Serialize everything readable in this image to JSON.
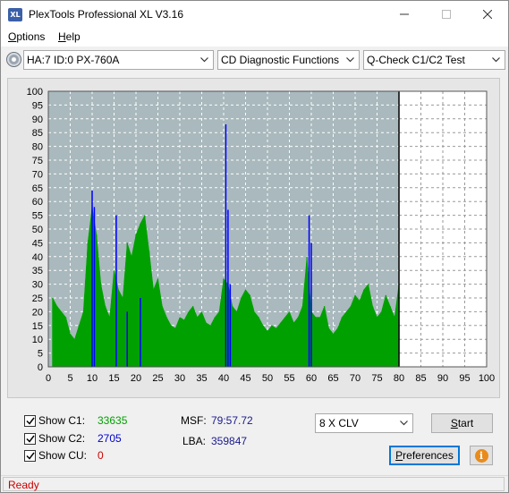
{
  "window": {
    "title": "PlexTools Professional XL V3.16",
    "app_icon_text": "XL"
  },
  "menu": {
    "options": "Options",
    "options_accel": "O",
    "options_rest": "ptions",
    "help": "Help",
    "help_accel": "H",
    "help_rest": "elp"
  },
  "toolbar": {
    "drive": "HA:7 ID:0  PX-760A",
    "function": "CD Diagnostic Functions",
    "test": "Q-Check C1/C2 Test"
  },
  "chart_data": {
    "type": "bar",
    "y_ticks": [
      "100",
      "95",
      "90",
      "85",
      "80",
      "75",
      "70",
      "65",
      "60",
      "55",
      "50",
      "45",
      "40",
      "35",
      "30",
      "25",
      "20",
      "15",
      "10",
      "5",
      "0"
    ],
    "x_ticks": [
      "0",
      "5",
      "10",
      "15",
      "20",
      "25",
      "30",
      "35",
      "40",
      "45",
      "50",
      "55",
      "60",
      "65",
      "70",
      "75",
      "80",
      "85",
      "90",
      "95",
      "100"
    ],
    "xlim": [
      0,
      100
    ],
    "ylim": [
      0,
      100
    ],
    "data_end_x": 80,
    "grid": true,
    "colors": {
      "plot_bg": "#a9b9bd",
      "c1": "#00a000",
      "c2": "#0000ff",
      "grid": "#ffffff",
      "end_marker": "#000000"
    },
    "series": [
      {
        "name": "C1",
        "points": [
          [
            1,
            25
          ],
          [
            2,
            22
          ],
          [
            3,
            20
          ],
          [
            4,
            18
          ],
          [
            5,
            12
          ],
          [
            6,
            10
          ],
          [
            7,
            15
          ],
          [
            8,
            20
          ],
          [
            9,
            45
          ],
          [
            10,
            58
          ],
          [
            11,
            48
          ],
          [
            12,
            30
          ],
          [
            13,
            22
          ],
          [
            14,
            18
          ],
          [
            15,
            35
          ],
          [
            16,
            28
          ],
          [
            17,
            25
          ],
          [
            18,
            45
          ],
          [
            19,
            40
          ],
          [
            20,
            48
          ],
          [
            21,
            52
          ],
          [
            22,
            55
          ],
          [
            23,
            42
          ],
          [
            24,
            28
          ],
          [
            25,
            32
          ],
          [
            26,
            22
          ],
          [
            27,
            18
          ],
          [
            28,
            15
          ],
          [
            29,
            14
          ],
          [
            30,
            18
          ],
          [
            31,
            17
          ],
          [
            32,
            20
          ],
          [
            33,
            22
          ],
          [
            34,
            18
          ],
          [
            35,
            20
          ],
          [
            36,
            16
          ],
          [
            37,
            15
          ],
          [
            38,
            18
          ],
          [
            39,
            20
          ],
          [
            40,
            32
          ],
          [
            41,
            30
          ],
          [
            42,
            22
          ],
          [
            43,
            20
          ],
          [
            44,
            25
          ],
          [
            45,
            28
          ],
          [
            46,
            26
          ],
          [
            47,
            20
          ],
          [
            48,
            18
          ],
          [
            49,
            15
          ],
          [
            50,
            13
          ],
          [
            51,
            15
          ],
          [
            52,
            14
          ],
          [
            53,
            16
          ],
          [
            54,
            18
          ],
          [
            55,
            20
          ],
          [
            56,
            16
          ],
          [
            57,
            18
          ],
          [
            58,
            22
          ],
          [
            59,
            40
          ],
          [
            60,
            20
          ],
          [
            61,
            18
          ],
          [
            62,
            18
          ],
          [
            63,
            22
          ],
          [
            64,
            14
          ],
          [
            65,
            12
          ],
          [
            66,
            14
          ],
          [
            67,
            18
          ],
          [
            68,
            20
          ],
          [
            69,
            22
          ],
          [
            70,
            26
          ],
          [
            71,
            24
          ],
          [
            72,
            28
          ],
          [
            73,
            30
          ],
          [
            74,
            22
          ],
          [
            75,
            18
          ],
          [
            76,
            20
          ],
          [
            77,
            26
          ],
          [
            78,
            22
          ],
          [
            79,
            18
          ],
          [
            80,
            30
          ]
        ]
      },
      {
        "name": "C2",
        "points": [
          [
            10,
            64
          ],
          [
            10.5,
            58
          ],
          [
            15.5,
            55
          ],
          [
            18,
            20
          ],
          [
            21,
            25
          ],
          [
            40.5,
            88
          ],
          [
            41,
            57
          ],
          [
            41.5,
            30
          ],
          [
            59.5,
            55
          ],
          [
            60,
            45
          ]
        ]
      }
    ]
  },
  "controls": {
    "show_c1_label": "Show C1:",
    "show_c2_label": "Show C2:",
    "show_cu_label": "Show CU:",
    "c1_value": "33635",
    "c2_value": "2705",
    "cu_value": "0",
    "c1_color": "#00a000",
    "c2_color": "#0000cc",
    "cu_color": "#cc0000",
    "msf_label": "MSF:",
    "msf_value": "79:57.72",
    "lba_label": "LBA:",
    "lba_value": "359847",
    "speed": "8 X CLV",
    "start_label": "Start",
    "start_accel": "S",
    "start_rest": "tart",
    "prefs_label": "Preferences",
    "prefs_accel": "P",
    "prefs_rest": "references",
    "info_icon": "info-icon"
  },
  "status": {
    "text": "Ready"
  }
}
